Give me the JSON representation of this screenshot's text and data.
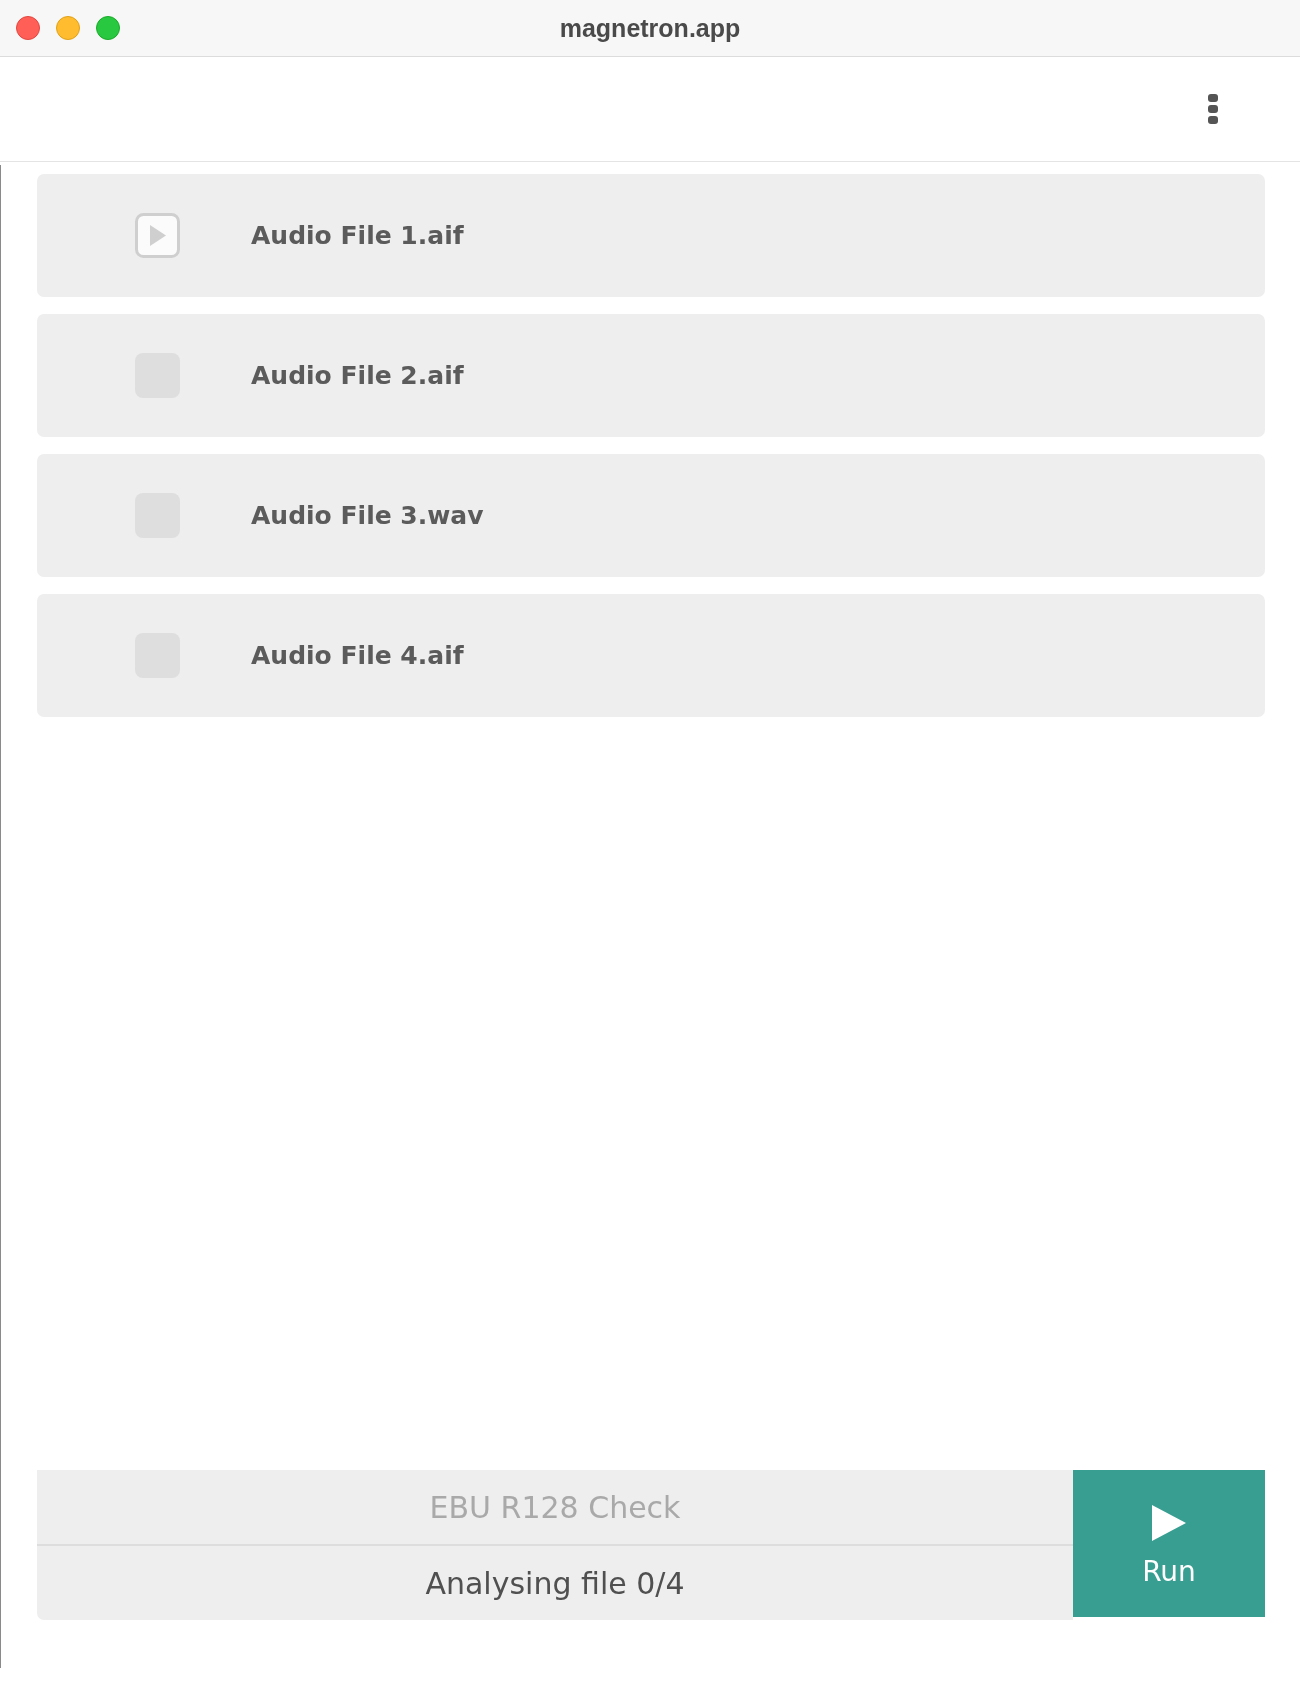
{
  "window": {
    "title": "magnetron.app"
  },
  "files": [
    {
      "name": "Audio File 1.aif",
      "active": true
    },
    {
      "name": "Audio File 2.aif",
      "active": false
    },
    {
      "name": "Audio File 3.wav",
      "active": false
    },
    {
      "name": "Audio File 4.aif",
      "active": false
    }
  ],
  "footer": {
    "title": "EBU R128 Check",
    "status": "Analysing file 0/4",
    "run_button": {
      "label": "Run"
    }
  }
}
